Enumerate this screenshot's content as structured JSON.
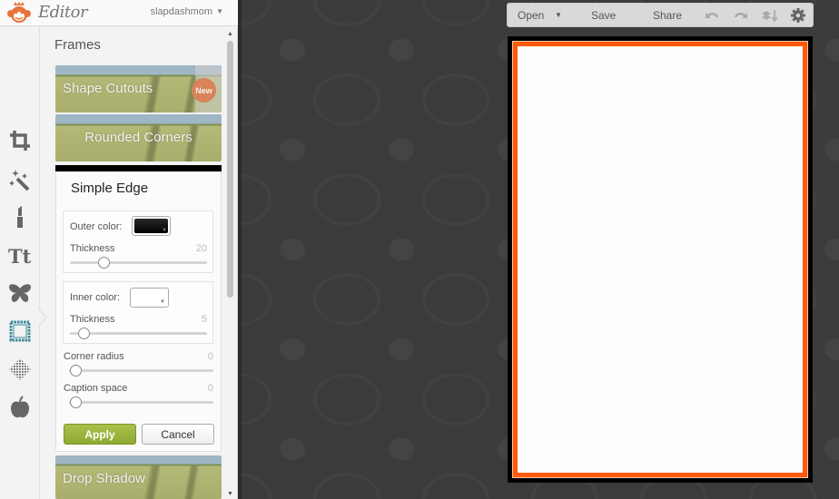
{
  "app": {
    "logo_text": "Editor",
    "user_menu": "slapdashmom",
    "user_menu_caret": "▼"
  },
  "tools": [
    {
      "name": "crop",
      "icon": "crop-icon"
    },
    {
      "name": "effects",
      "icon": "magic-wand-icon"
    },
    {
      "name": "touch-up",
      "icon": "lipstick-icon"
    },
    {
      "name": "text",
      "icon": "text-icon",
      "glyph": "Tt"
    },
    {
      "name": "overlays",
      "icon": "butterfly-icon"
    },
    {
      "name": "frames",
      "icon": "frame-icon",
      "active": true
    },
    {
      "name": "textures",
      "icon": "texture-icon"
    },
    {
      "name": "themes",
      "icon": "apple-icon"
    }
  ],
  "panel": {
    "title": "Frames",
    "frames": [
      {
        "label": "Shape Cutouts",
        "badge": "New"
      },
      {
        "label": "Rounded Corners"
      },
      {
        "label": "Drop Shadow"
      }
    ],
    "simple_edge": {
      "title": "Simple Edge",
      "outer_color": {
        "label": "Outer color:",
        "value": "#111111"
      },
      "outer_thickness": {
        "label": "Thickness",
        "value": "20",
        "fraction": 0.2
      },
      "inner_color": {
        "label": "Inner color:",
        "value": "#ffffff"
      },
      "inner_thickness": {
        "label": "Thickness",
        "value": "5",
        "fraction": 0.05
      },
      "corner_radius": {
        "label": "Corner radius",
        "value": "0",
        "fraction": 0
      },
      "caption_space": {
        "label": "Caption space",
        "value": "0",
        "fraction": 0
      },
      "apply_label": "Apply",
      "cancel_label": "Cancel"
    },
    "scroll": {
      "up": "▲",
      "down": "▼"
    }
  },
  "toolbar": {
    "open_label": "Open",
    "open_caret": "▼",
    "save_label": "Save",
    "share_label": "Share"
  },
  "canvas": {
    "outer_color": "#000000",
    "frame_color": "#ff5a0a",
    "inner_color": "#fdfdfd"
  }
}
